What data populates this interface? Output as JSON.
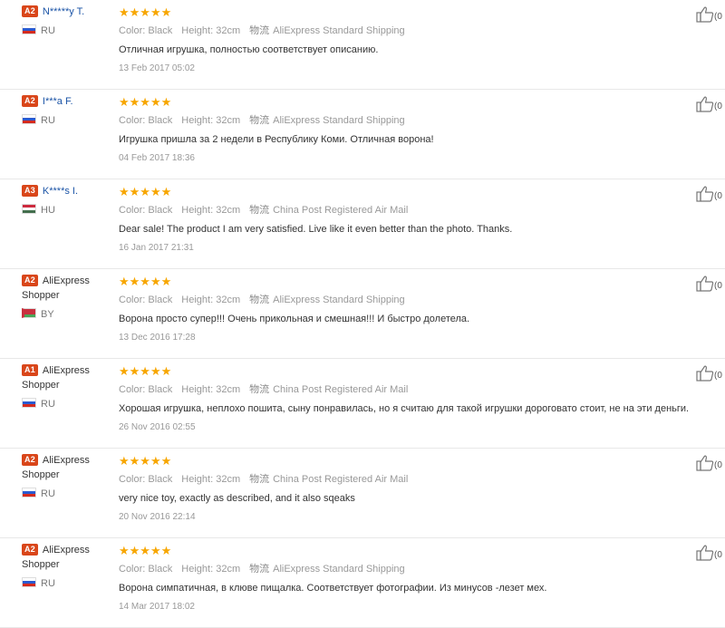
{
  "reviews": [
    {
      "badge": "A2",
      "name": "N*****y T.",
      "name_style": "link",
      "country": "RU",
      "flag": "ru",
      "stars": "★★★★★",
      "color": "Color: Black",
      "height": "Height: 32cm",
      "logistics_label": "物流",
      "shipping": "AliExpress Standard Shipping",
      "text": "Отличная игрушка, полностью соответствует описанию.",
      "date": "13 Feb 2017 05:02",
      "helpful": "(0"
    },
    {
      "badge": "A2",
      "name": "I***a F.",
      "name_style": "link",
      "country": "RU",
      "flag": "ru",
      "stars": "★★★★★",
      "color": "Color: Black",
      "height": "Height: 32cm",
      "logistics_label": "物流",
      "shipping": "AliExpress Standard Shipping",
      "text": "Игрушка пришла за 2 недели в Республику Коми. Отличная ворона!",
      "date": "04 Feb 2017 18:36",
      "helpful": "(0"
    },
    {
      "badge": "A3",
      "name": "K****s I.",
      "name_style": "link",
      "country": "HU",
      "flag": "hu",
      "stars": "★★★★★",
      "color": "Color: Black",
      "height": "Height: 32cm",
      "logistics_label": "物流",
      "shipping": "China Post Registered Air Mail",
      "text": "Dear sale! The product I am very satisfied. Live like it even better than the photo. Thanks.",
      "date": "16 Jan 2017 21:31",
      "helpful": "(0"
    },
    {
      "badge": "A2",
      "name": "AliExpress Shopper",
      "name_style": "plain",
      "country": "BY",
      "flag": "by",
      "stars": "★★★★★",
      "color": "Color: Black",
      "height": "Height: 32cm",
      "logistics_label": "物流",
      "shipping": "AliExpress Standard Shipping",
      "text": "Ворона просто супер!!! Очень прикольная и смешная!!! И быстро долетела.",
      "date": "13 Dec 2016 17:28",
      "helpful": "(0"
    },
    {
      "badge": "A1",
      "name": "AliExpress Shopper",
      "name_style": "plain",
      "country": "RU",
      "flag": "ru",
      "stars": "★★★★★",
      "color": "Color: Black",
      "height": "Height: 32cm",
      "logistics_label": "物流",
      "shipping": "China Post Registered Air Mail",
      "text": "Хорошая игрушка, неплохо пошита, сыну понравилась, но я считаю для такой игрушки дороговато стоит, не на эти деньги.",
      "date": "26 Nov 2016 02:55",
      "helpful": "(0"
    },
    {
      "badge": "A2",
      "name": "AliExpress Shopper",
      "name_style": "plain",
      "country": "RU",
      "flag": "ru",
      "stars": "★★★★★",
      "color": "Color: Black",
      "height": "Height: 32cm",
      "logistics_label": "物流",
      "shipping": "China Post Registered Air Mail",
      "text": "very nice toy, exactly as described, and it also sqeaks",
      "date": "20 Nov 2016 22:14",
      "helpful": "(0"
    },
    {
      "badge": "A2",
      "name": "AliExpress Shopper",
      "name_style": "plain",
      "country": "RU",
      "flag": "ru",
      "stars": "★★★★★",
      "color": "Color: Black",
      "height": "Height: 32cm",
      "logistics_label": "物流",
      "shipping": "AliExpress Standard Shipping",
      "text": "Ворона симпатичная, в клюве пищалка. Соответствует фотографии. Из минусов -лезет мех.",
      "date": "14 Mar 2017 18:02",
      "helpful": "(0"
    }
  ],
  "colors": {
    "badge": "#d9461a",
    "stars": "#f7a600",
    "name_link": "#1a53a6"
  },
  "icons": {
    "helpful": "thumbs-up-icon",
    "flag": "country-flag-icon"
  }
}
